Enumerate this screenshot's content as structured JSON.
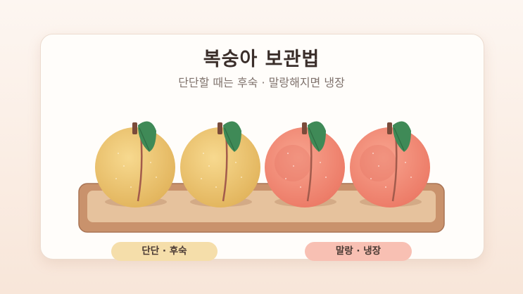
{
  "header": {
    "title": "복숭아 보관법",
    "subtitle": "단단할 때는 후숙 · 말랑해지면 냉장"
  },
  "labels": {
    "firm": "단단 · 후숙",
    "soft": "말랑 · 냉장"
  },
  "peaches": [
    {
      "state": "firm",
      "color": "#ecc06a"
    },
    {
      "state": "firm",
      "color": "#ecc06a"
    },
    {
      "state": "soft",
      "color": "#f08a72"
    },
    {
      "state": "soft",
      "color": "#f08a72"
    }
  ],
  "colors": {
    "tray": "#c9926c",
    "leaf": "#3f8a57",
    "firm_label_bg": "#f5deaa",
    "soft_label_bg": "#f8c0b3"
  }
}
